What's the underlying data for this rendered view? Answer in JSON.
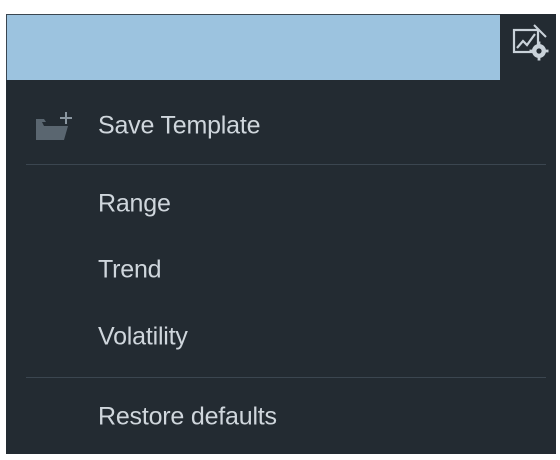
{
  "menu": {
    "items": [
      {
        "label": "Save Template",
        "icon": "folder-add-icon"
      },
      {
        "label": "Range"
      },
      {
        "label": "Trend"
      },
      {
        "label": "Volatility"
      },
      {
        "label": "Restore defaults"
      }
    ]
  },
  "toolbar": {
    "settings_icon": "chart-settings-icon"
  },
  "colors": {
    "header_bar": "#9cc3df",
    "menu_background": "#232b32",
    "menu_text": "#cfd6dc",
    "divider": "#3b4650"
  }
}
